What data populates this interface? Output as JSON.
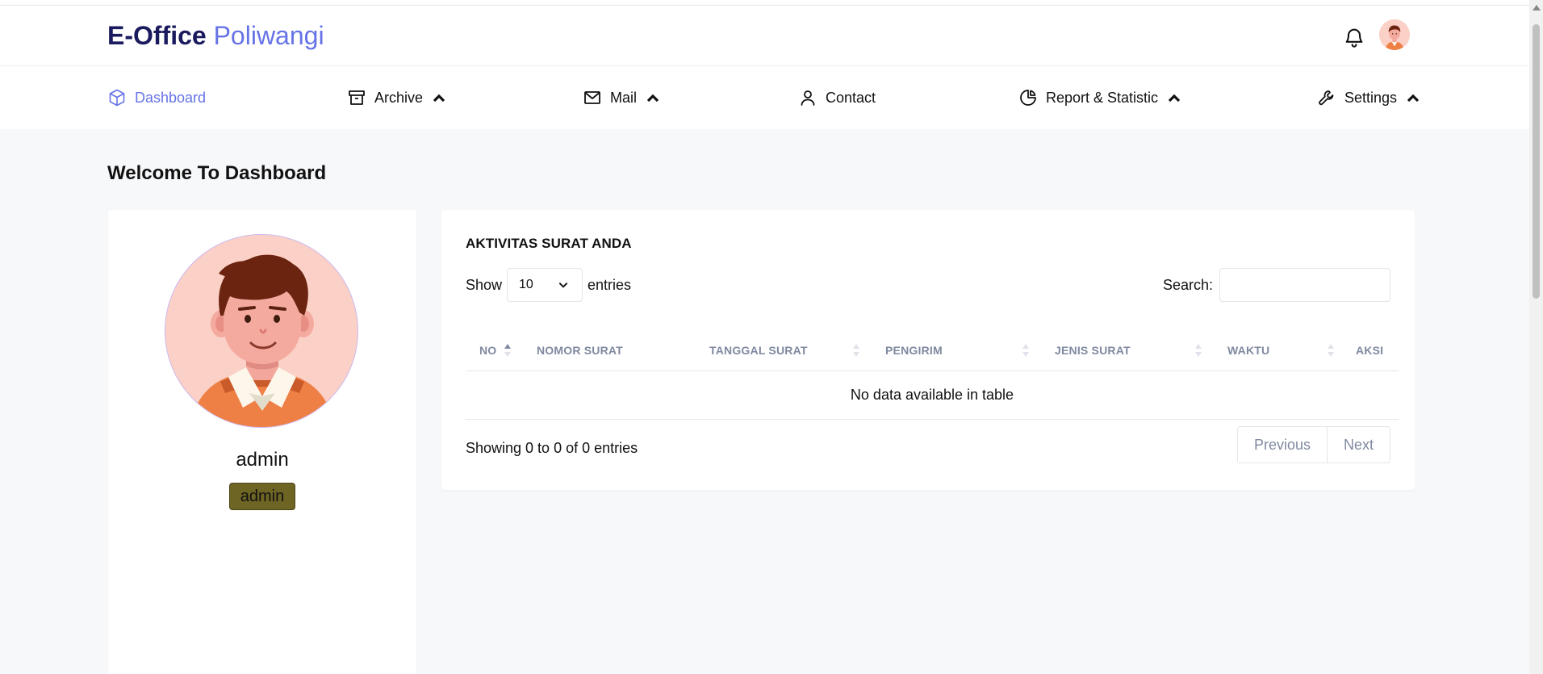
{
  "brand": {
    "part1": "E-Office",
    "part2": "Poliwangi"
  },
  "nav": [
    {
      "label": "Dashboard",
      "icon": "cube-icon",
      "active": true
    },
    {
      "label": "Archive",
      "icon": "archive-icon"
    },
    {
      "label": "Mail",
      "icon": "mail-icon"
    },
    {
      "label": "Contact",
      "icon": "user-icon"
    },
    {
      "label": "Report & Statistic",
      "icon": "pie-chart-icon"
    },
    {
      "label": "Settings",
      "icon": "wrench-icon"
    }
  ],
  "page": {
    "title": "Welcome To Dashboard"
  },
  "profile": {
    "name": "admin",
    "role": "admin"
  },
  "table_card": {
    "title": "AKTIVITAS SURAT ANDA",
    "show_label": "Show",
    "entries_value": "10",
    "entries_label": "entries",
    "search_label": "Search:",
    "search_value": "",
    "columns": [
      "NO",
      "NOMOR SURAT",
      "TANGGAL SURAT",
      "PENGIRIM",
      "JENIS SURAT",
      "WAKTU",
      "AKSI"
    ],
    "empty_message": "No data available in table",
    "info": "Showing 0 to 0 of 0 entries",
    "prev_label": "Previous",
    "next_label": "Next"
  },
  "colors": {
    "accent": "#6673e6",
    "brand_dark": "#1a1a5e",
    "badge_bg": "#6e6424"
  }
}
